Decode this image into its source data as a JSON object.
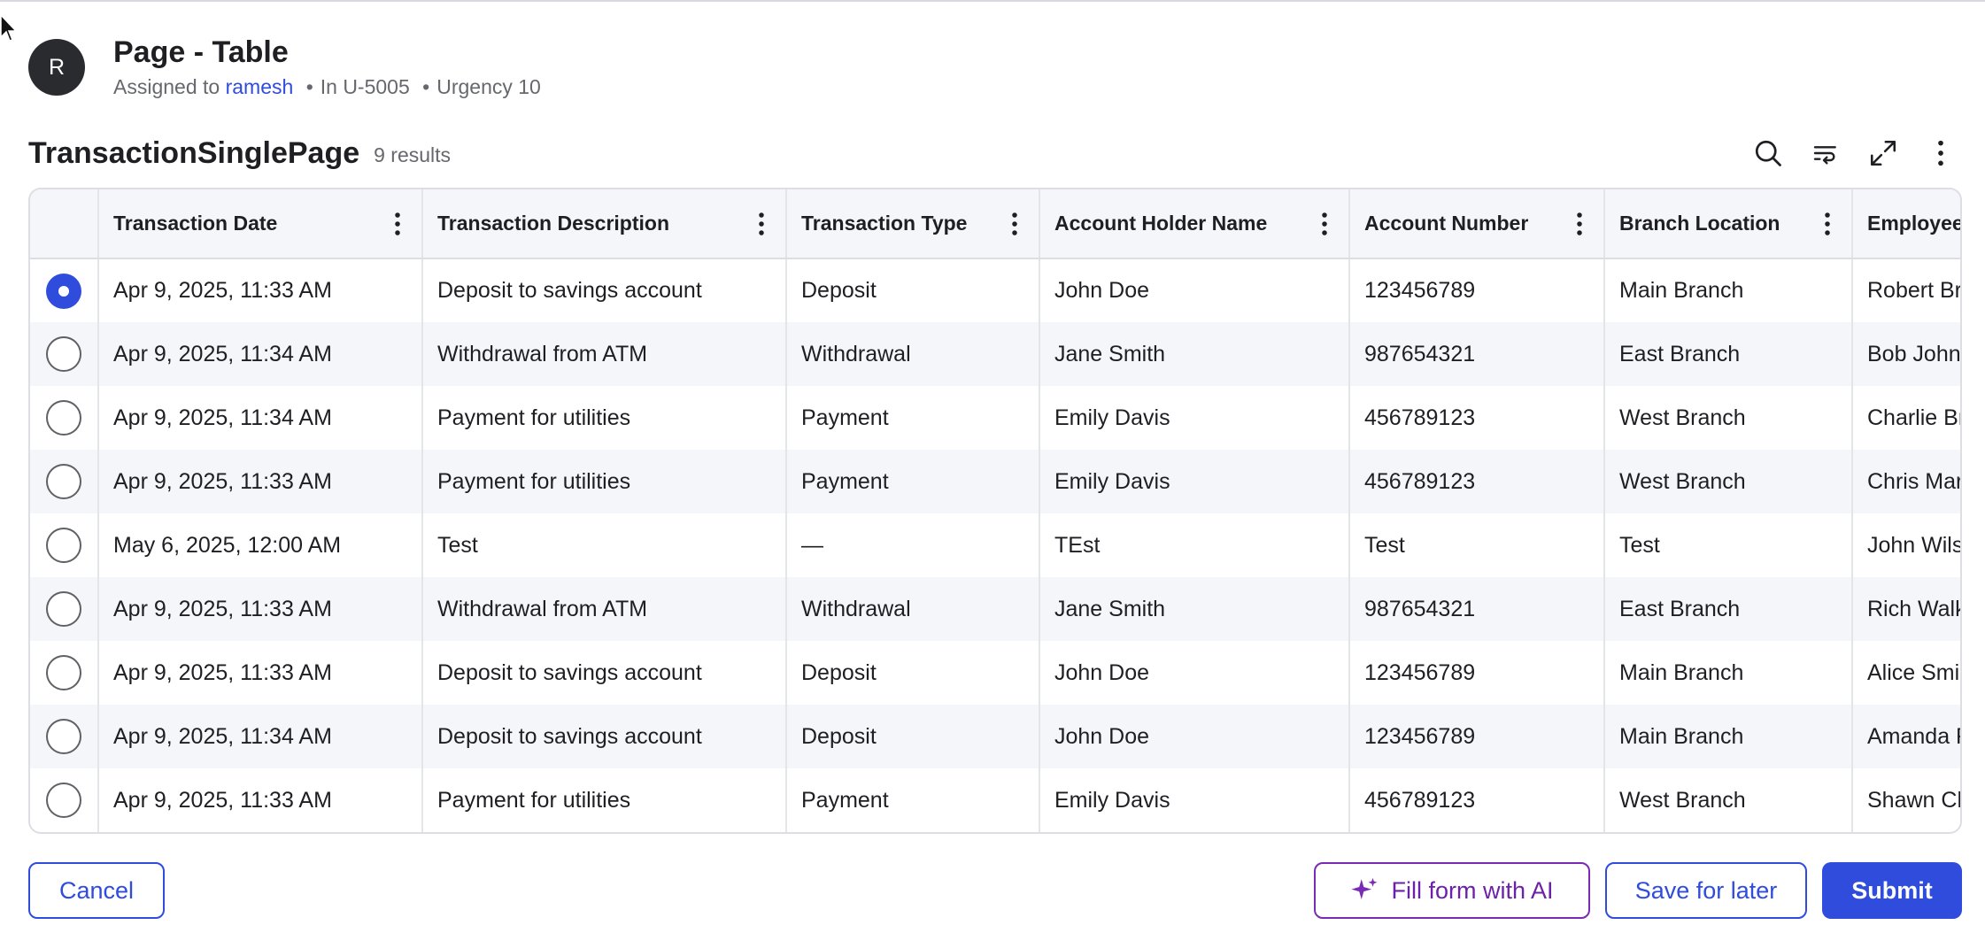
{
  "header": {
    "avatar_initial": "R",
    "title": "Page - Table",
    "assigned_prefix": "Assigned to",
    "assignee": "ramesh",
    "case_ref": "In U-5005",
    "urgency": "Urgency 10",
    "separator": "•"
  },
  "table": {
    "title": "TransactionSinglePage",
    "results": "9 results",
    "toolbar_icons": [
      "search-icon",
      "wrap-icon",
      "expand-icon",
      "more-vertical-icon"
    ],
    "columns": [
      "Transaction Date",
      "Transaction Description",
      "Transaction Type",
      "Account Holder Name",
      "Account Number",
      "Branch Location",
      "Employee"
    ],
    "rows": [
      {
        "selected": true,
        "cells": [
          "Apr 9, 2025, 11:33 AM",
          "Deposit to savings account",
          "Deposit",
          "John Doe",
          "123456789",
          "Main Branch",
          "Robert Br"
        ]
      },
      {
        "selected": false,
        "cells": [
          "Apr 9, 2025, 11:34 AM",
          "Withdrawal from ATM",
          "Withdrawal",
          "Jane Smith",
          "987654321",
          "East Branch",
          "Bob John"
        ]
      },
      {
        "selected": false,
        "cells": [
          "Apr 9, 2025, 11:34 AM",
          "Payment for utilities",
          "Payment",
          "Emily Davis",
          "456789123",
          "West Branch",
          "Charlie Br"
        ]
      },
      {
        "selected": false,
        "cells": [
          "Apr 9, 2025, 11:33 AM",
          "Payment for utilities",
          "Payment",
          "Emily Davis",
          "456789123",
          "West Branch",
          "Chris Mar"
        ]
      },
      {
        "selected": false,
        "cells": [
          "May 6, 2025, 12:00 AM",
          "Test",
          "—",
          "TEst",
          "Test",
          "Test",
          "John Wils"
        ]
      },
      {
        "selected": false,
        "cells": [
          "Apr 9, 2025, 11:33 AM",
          "Withdrawal from ATM",
          "Withdrawal",
          "Jane Smith",
          "987654321",
          "East Branch",
          "Rich Walk"
        ]
      },
      {
        "selected": false,
        "cells": [
          "Apr 9, 2025, 11:33 AM",
          "Deposit to savings account",
          "Deposit",
          "John Doe",
          "123456789",
          "Main Branch",
          "Alice Smi"
        ]
      },
      {
        "selected": false,
        "cells": [
          "Apr 9, 2025, 11:34 AM",
          "Deposit to savings account",
          "Deposit",
          "John Doe",
          "123456789",
          "Main Branch",
          "Amanda F"
        ]
      },
      {
        "selected": false,
        "cells": [
          "Apr 9, 2025, 11:33 AM",
          "Payment for utilities",
          "Payment",
          "Emily Davis",
          "456789123",
          "West Branch",
          "Shawn Ch"
        ]
      }
    ]
  },
  "footer": {
    "cancel_label": "Cancel",
    "ai_label": "Fill form with AI",
    "save_later_label": "Save for later",
    "submit_label": "Submit"
  },
  "colors": {
    "accent": "#2f4cdc",
    "ai_accent": "#7a2bb5",
    "avatar_bg": "#2a2b2f"
  }
}
